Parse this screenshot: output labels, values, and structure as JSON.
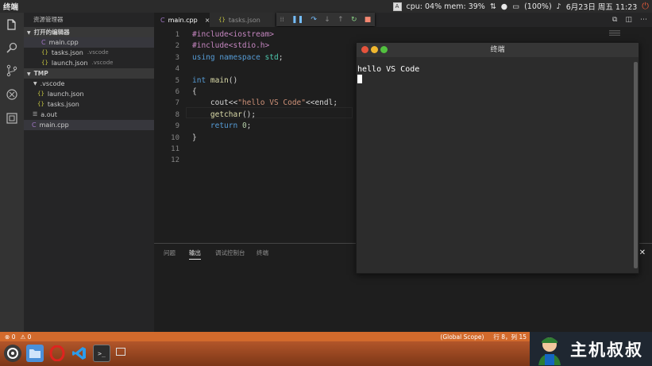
{
  "system": {
    "app_title": "终端",
    "cpu_mem": "cpu: 04% mem: 39%",
    "battery": "(100%)",
    "datetime": "6月23日 周五 11:23",
    "input_method": "A"
  },
  "sidebar": {
    "title": "资源管理器",
    "open_editors_label": "打开的编辑器",
    "open_editors": [
      {
        "name": "main.cpp",
        "hint": ""
      },
      {
        "name": "tasks.json",
        "hint": ".vscode"
      },
      {
        "name": "launch.json",
        "hint": ".vscode"
      }
    ],
    "folder_label": "TMP",
    "tree": [
      {
        "name": ".vscode"
      },
      {
        "name": "launch.json"
      },
      {
        "name": "tasks.json"
      },
      {
        "name": "a.out"
      },
      {
        "name": "main.cpp"
      }
    ]
  },
  "tabs": [
    {
      "label": "main.cpp",
      "close": "×"
    },
    {
      "label": "tasks.json"
    }
  ],
  "editor": {
    "line_numbers": [
      "1",
      "2",
      "3",
      "4",
      "5",
      "6",
      "7",
      "8",
      "9",
      "10",
      "11",
      "12"
    ],
    "lines": [
      [
        {
          "t": "#include<iostream>",
          "c": "pre"
        }
      ],
      [
        {
          "t": "#include<stdio.h>",
          "c": "pre"
        }
      ],
      [
        {
          "t": "using ",
          "c": "kw"
        },
        {
          "t": "namespace ",
          "c": "kw"
        },
        {
          "t": "std",
          "c": "type"
        },
        {
          "t": ";",
          "c": "id"
        }
      ],
      [],
      [
        {
          "t": "int ",
          "c": "kw"
        },
        {
          "t": "main",
          "c": "fn"
        },
        {
          "t": "()",
          "c": "id"
        }
      ],
      [
        {
          "t": "{",
          "c": "id"
        }
      ],
      [
        {
          "t": "    cout<<",
          "c": "id"
        },
        {
          "t": "\"hello VS Code\"",
          "c": "str"
        },
        {
          "t": "<<endl;",
          "c": "id"
        }
      ],
      [
        {
          "t": "    ",
          "c": "id"
        },
        {
          "t": "getchar",
          "c": "fn"
        },
        {
          "t": "();",
          "c": "id"
        }
      ],
      [
        {
          "t": "    ",
          "c": "id"
        },
        {
          "t": "return ",
          "c": "kw"
        },
        {
          "t": "0",
          "c": "num"
        },
        {
          "t": ";",
          "c": "id"
        }
      ],
      [
        {
          "t": "}",
          "c": "id"
        }
      ],
      [],
      []
    ]
  },
  "panel": {
    "tabs": [
      "问题",
      "输出",
      "调试控制台",
      "终端"
    ],
    "active_tab": "输出"
  },
  "terminal": {
    "title": "终端",
    "output": "hello VS Code"
  },
  "status": {
    "errors": "0",
    "warnings": "0",
    "scope": "(Global Scope)",
    "position": "行 8，列 15"
  },
  "watermark": {
    "text": "主机叔叔"
  },
  "colors": {
    "statusbar": "#d26a2c",
    "activitybar": "#333333",
    "sidebar": "#252526",
    "editor": "#1e1e1e"
  }
}
